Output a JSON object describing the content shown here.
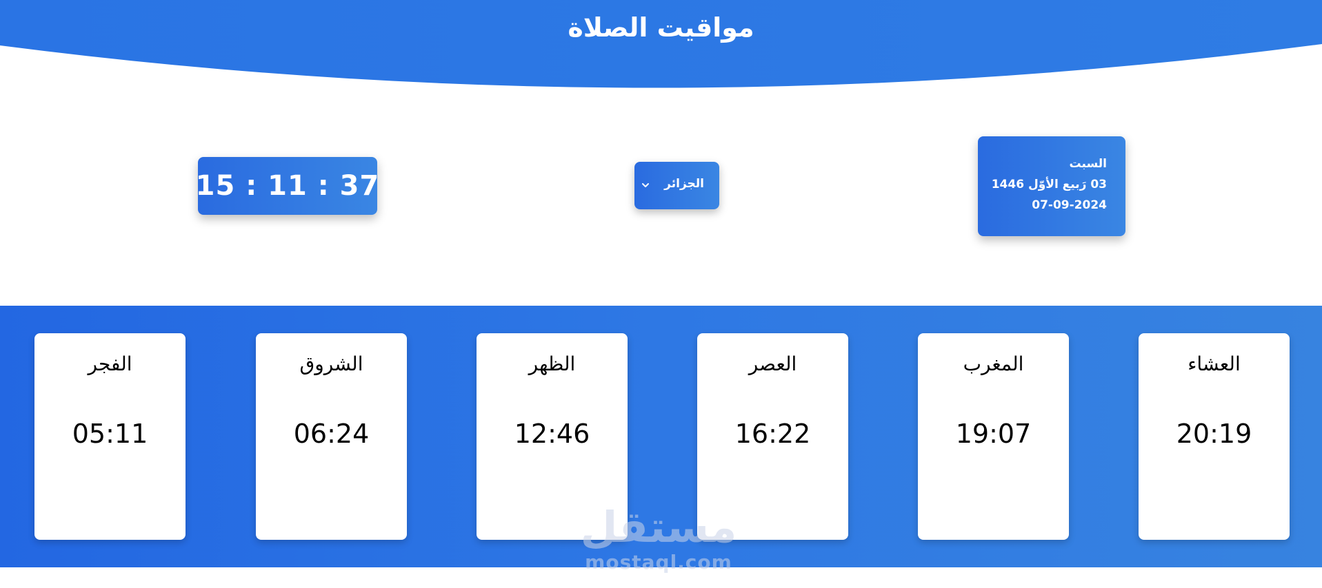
{
  "header": {
    "title": "مواقيت الصلاة"
  },
  "clock": {
    "time": "15 : 11 : 37"
  },
  "city_select": {
    "selected": "الجزائر",
    "icon": "chevron-down-icon"
  },
  "date_card": {
    "weekday": "السبت",
    "hijri": "03 رَبيع الأوّل 1446",
    "gregorian": "07-09-2024"
  },
  "prayers": [
    {
      "name": "العشاء",
      "time": "20:19"
    },
    {
      "name": "المغرب",
      "time": "19:07"
    },
    {
      "name": "العصر",
      "time": "16:22"
    },
    {
      "name": "الظهر",
      "time": "12:46"
    },
    {
      "name": "الشروق",
      "time": "06:24"
    },
    {
      "name": "الفجر",
      "time": "05:11"
    }
  ],
  "watermark": {
    "arabic": "مستقل",
    "latin": "mostaql.com"
  },
  "colors": {
    "primary_blue": "#2a78e4",
    "card_white": "#ffffff",
    "text": "#000000"
  }
}
